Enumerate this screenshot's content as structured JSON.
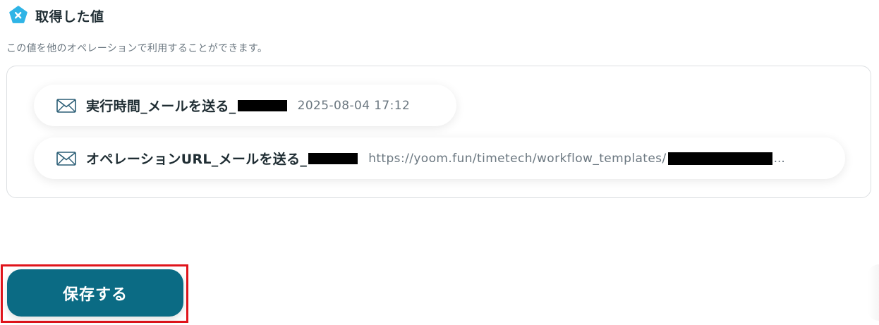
{
  "section": {
    "title": "取得した値",
    "description": "この値を他のオペレーションで利用することができます。",
    "icon": "yoom-logo-icon"
  },
  "values": [
    {
      "icon": "mail-icon",
      "label": "実行時間_メールを送る_",
      "value": "2025-08-04 17:12",
      "redacted": true
    },
    {
      "icon": "mail-icon",
      "label": "オペレーションURL_メールを送る_",
      "value": "https://yoom.fun/timetech/workflow_templates/",
      "value_suffix": "...",
      "redacted": true
    }
  ],
  "actions": {
    "save_label": "保存する"
  },
  "colors": {
    "primary": "#0b6b84",
    "logo": "#2fb4e6",
    "highlight": "#e0141b",
    "text": "#1f2d33",
    "muted": "#6b7780",
    "border": "#dcdfe2"
  }
}
